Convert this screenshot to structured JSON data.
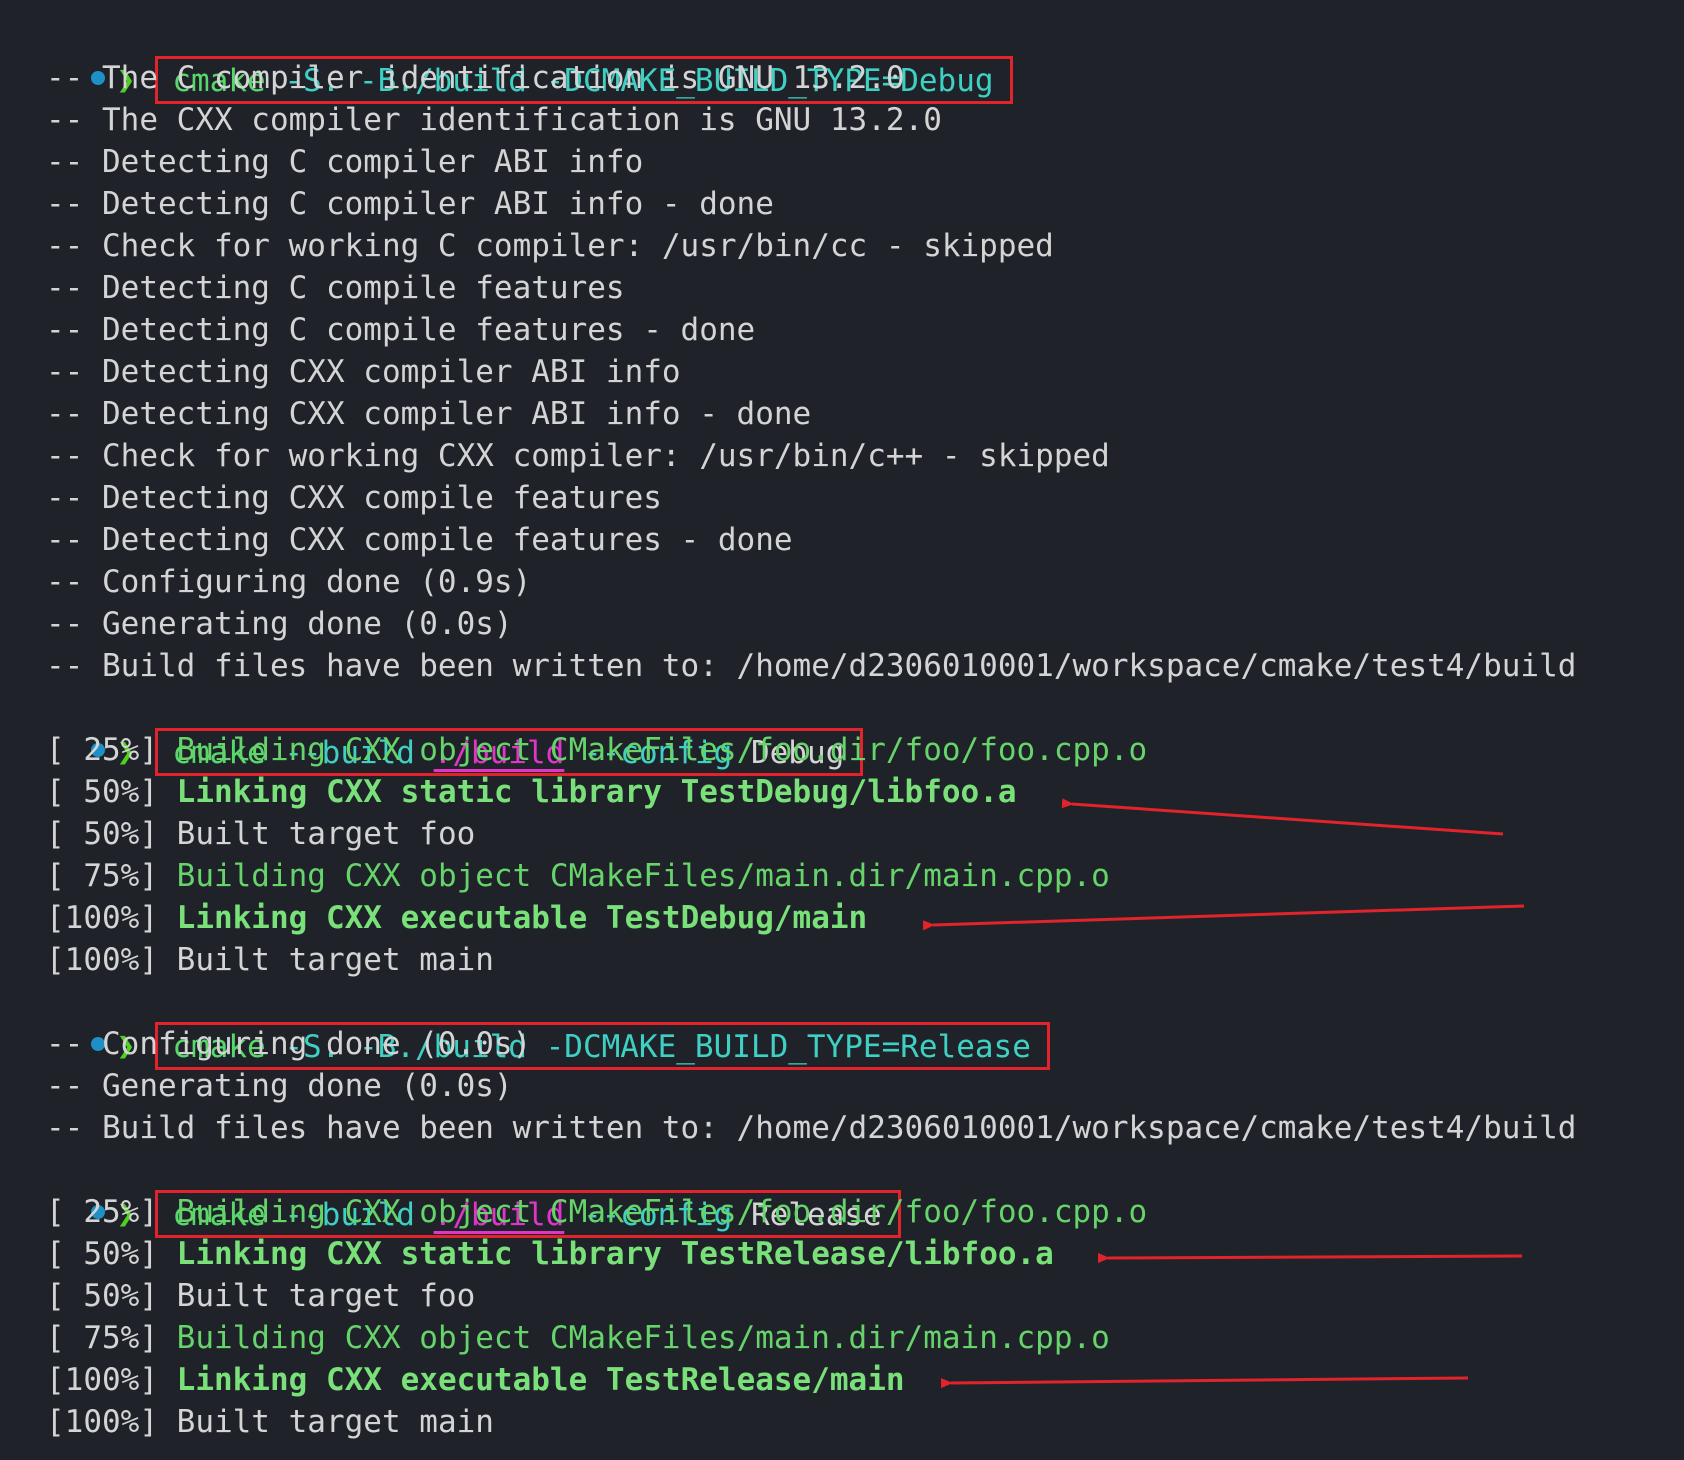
{
  "colors": {
    "background": "#1f2329",
    "prompt_dot": "#1e8fc7",
    "prompt_chevron": "#4fd11f",
    "highlight_box": "#e3232b",
    "annotation_arrow": "#e3232b"
  },
  "prompt_symbol": "❯",
  "commands": {
    "cmd1": {
      "prog": "cmake",
      "args": "-S. -B./build -DCMAKE_BUILD_TYPE=Debug"
    },
    "cmd2": {
      "prog": "cmake",
      "flag1": "--build",
      "path": "./build",
      "flag2": "--config",
      "arg": "Debug"
    },
    "cmd3": {
      "prog": "cmake",
      "args": "-S. -B./build -DCMAKE_BUILD_TYPE=Release"
    },
    "cmd4": {
      "prog": "cmake",
      "flag1": "--build",
      "path": "./build",
      "flag2": "--config",
      "arg": "Release"
    }
  },
  "config1_output": [
    "-- The C compiler identification is GNU 13.2.0",
    "-- The CXX compiler identification is GNU 13.2.0",
    "-- Detecting C compiler ABI info",
    "-- Detecting C compiler ABI info - done",
    "-- Check for working C compiler: /usr/bin/cc - skipped",
    "-- Detecting C compile features",
    "-- Detecting C compile features - done",
    "-- Detecting CXX compiler ABI info",
    "-- Detecting CXX compiler ABI info - done",
    "-- Check for working CXX compiler: /usr/bin/c++ - skipped",
    "-- Detecting CXX compile features",
    "-- Detecting CXX compile features - done",
    "-- Configuring done (0.9s)",
    "-- Generating done (0.0s)",
    "-- Build files have been written to: /home/d2306010001/workspace/cmake/test4/build"
  ],
  "build_debug": [
    {
      "pct": "[ 25%]",
      "msg": "Building CXX object CMakeFiles/foo.dir/foo/foo.cpp.o",
      "style": "green"
    },
    {
      "pct": "[ 50%]",
      "msg": "Linking CXX static library TestDebug/libfoo.a",
      "style": "bold"
    },
    {
      "pct": "[ 50%]",
      "msg": "Built target foo",
      "style": "plain"
    },
    {
      "pct": "[ 75%]",
      "msg": "Building CXX object CMakeFiles/main.dir/main.cpp.o",
      "style": "green"
    },
    {
      "pct": "[100%]",
      "msg": "Linking CXX executable TestDebug/main",
      "style": "bold"
    },
    {
      "pct": "[100%]",
      "msg": "Built target main",
      "style": "plain"
    }
  ],
  "config2_output": [
    "-- Configuring done (0.0s)",
    "-- Generating done (0.0s)",
    "-- Build files have been written to: /home/d2306010001/workspace/cmake/test4/build"
  ],
  "build_release": [
    {
      "pct": "[ 25%]",
      "msg": "Building CXX object CMakeFiles/foo.dir/foo/foo.cpp.o",
      "style": "green"
    },
    {
      "pct": "[ 50%]",
      "msg": "Linking CXX static library TestRelease/libfoo.a",
      "style": "bold"
    },
    {
      "pct": "[ 50%]",
      "msg": "Built target foo",
      "style": "plain"
    },
    {
      "pct": "[ 75%]",
      "msg": "Building CXX object CMakeFiles/main.dir/main.cpp.o",
      "style": "green"
    },
    {
      "pct": "[100%]",
      "msg": "Linking CXX executable TestRelease/main",
      "style": "bold"
    },
    {
      "pct": "[100%]",
      "msg": "Built target main",
      "style": "plain"
    }
  ]
}
